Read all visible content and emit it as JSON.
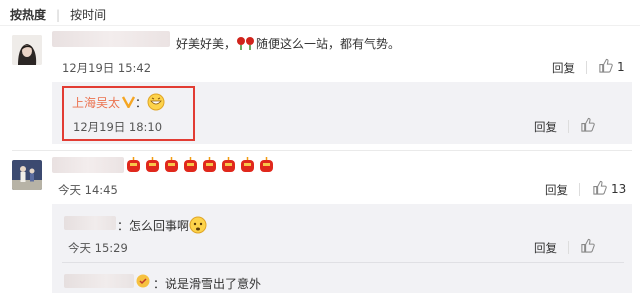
{
  "sort": {
    "hot": "按热度",
    "time": "按时间"
  },
  "comments": [
    {
      "text": "好美好美，",
      "text2": "随便这么一站，都有气势。",
      "time": "12月19日 15:42",
      "reply_label": "回复",
      "likes": "1"
    },
    {
      "name": "上海吴太",
      "colon": "：",
      "time": "12月19日 18:10",
      "reply_label": "回复"
    },
    {
      "time": "今天 14:45",
      "reply_label": "回复",
      "likes": "13"
    },
    {
      "text": "：怎么回事啊",
      "time": "今天 15:29",
      "reply_label": "回复"
    },
    {
      "text": "：说是滑雪出了意外"
    }
  ],
  "colors": {
    "highlight": "#e23c33",
    "name": "#eb7350",
    "verified": "#f5a623"
  }
}
